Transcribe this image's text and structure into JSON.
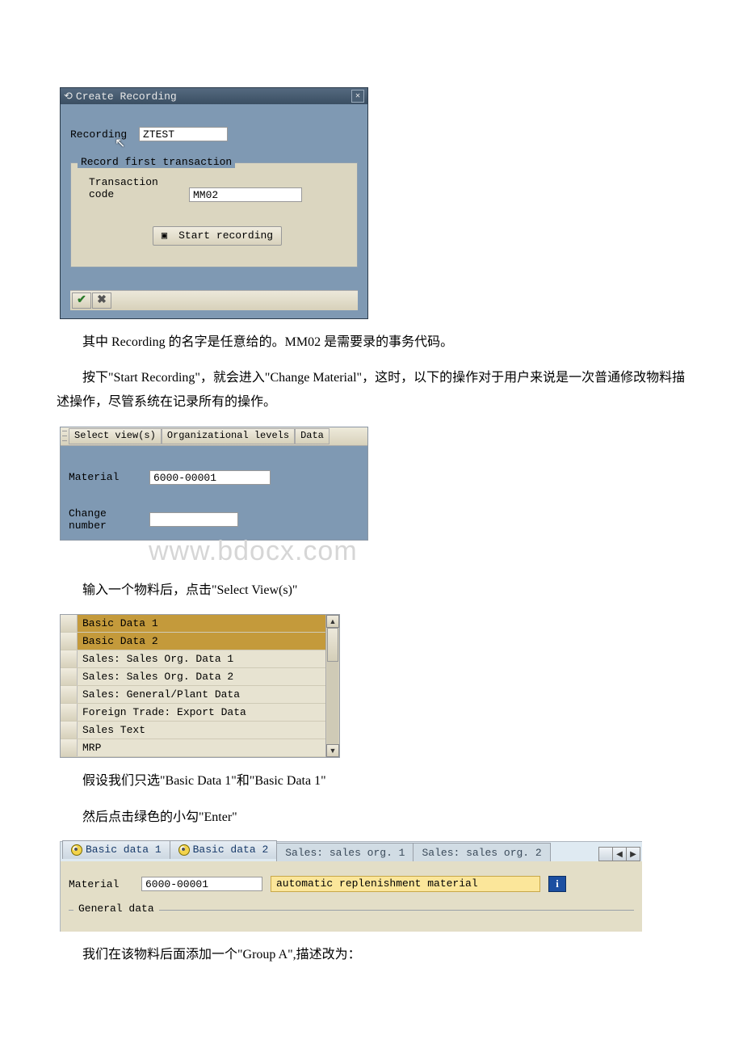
{
  "dialog1": {
    "title": "Create Recording",
    "recording_label": "Recording",
    "recording_value": "ZTEST",
    "group_title": "Record first transaction",
    "tcode_label": "Transaction code",
    "tcode_value": "MM02",
    "start_label": "Start recording"
  },
  "para1": "其中 Recording 的名字是任意给的。MM02 是需要录的事务代码。",
  "para2": "按下\"Start Recording\"，就会进入\"Change Material\"，这时，以下的操作对于用户来说是一次普通修改物料描述操作，尽管系统在记录所有的操作。",
  "panel2": {
    "btn_select_views": "Select view(s)",
    "btn_org_levels": "Organizational levels",
    "btn_data": "Data",
    "material_label": "Material",
    "material_value": "6000-00001",
    "change_number_label": "Change number",
    "change_number_value": ""
  },
  "watermark": "www.bdocx.com",
  "para3": "输入一个物料后，点击\"Select View(s)\"",
  "viewlist": {
    "items": [
      {
        "label": "Basic Data 1",
        "selected": true
      },
      {
        "label": "Basic Data 2",
        "selected": true
      },
      {
        "label": "Sales: Sales Org. Data 1",
        "selected": false
      },
      {
        "label": "Sales: Sales Org. Data 2",
        "selected": false
      },
      {
        "label": "Sales: General/Plant Data",
        "selected": false
      },
      {
        "label": "Foreign Trade: Export Data",
        "selected": false
      },
      {
        "label": "Sales Text",
        "selected": false
      },
      {
        "label": "MRP",
        "selected": false
      }
    ]
  },
  "para4": "假设我们只选\"Basic Data 1\"和\"Basic Data 1\"",
  "para5": "然后点击绿色的小勾\"Enter\"",
  "tabstrip": {
    "tabs": [
      {
        "label": "Basic data 1",
        "active": true
      },
      {
        "label": "Basic data 2",
        "active": true
      },
      {
        "label": "Sales: sales org. 1",
        "active": false
      },
      {
        "label": "Sales: sales org. 2",
        "active": false
      }
    ],
    "material_label": "Material",
    "material_value": "6000-00001",
    "description_value": "automatic replenishment material",
    "general_data_label": "General data"
  },
  "para6": "我们在该物料后面添加一个\"Group A\",描述改为："
}
